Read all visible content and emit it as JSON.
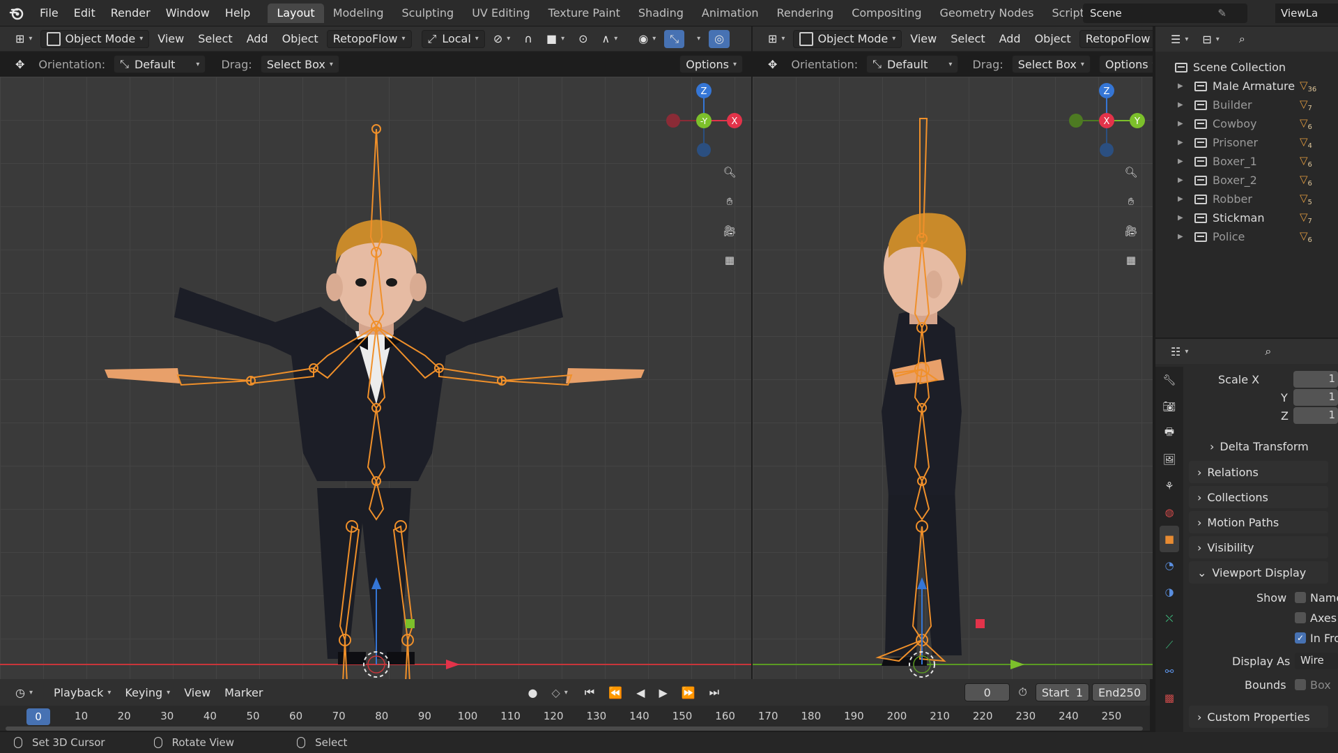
{
  "app": {
    "menus": [
      "File",
      "Edit",
      "Render",
      "Window",
      "Help"
    ],
    "workspaces": [
      "Layout",
      "Modeling",
      "Sculpting",
      "UV Editing",
      "Texture Paint",
      "Shading",
      "Animation",
      "Rendering",
      "Compositing",
      "Geometry Nodes",
      "Scripting"
    ],
    "active_workspace": "Layout",
    "scene": "Scene",
    "view_layer": "ViewLa"
  },
  "viewport_left": {
    "mode": "Object Mode",
    "menu": [
      "View",
      "Select",
      "Add",
      "Object"
    ],
    "addon_menu": "RetopoFlow",
    "transform_space": "Local",
    "orientation_label": "Orientation:",
    "orientation_value": "Default",
    "drag_label": "Drag:",
    "drag_value": "Select Box",
    "options": "Options",
    "gizmo": {
      "z": "Z",
      "y": "-Y",
      "x": "X"
    }
  },
  "viewport_right": {
    "mode": "Object Mode",
    "menu": [
      "View",
      "Select",
      "Add",
      "Object"
    ],
    "addon_menu": "RetopoFlow",
    "orientation_label": "Orientation:",
    "orientation_value": "Default",
    "drag_label": "Drag:",
    "drag_value": "Select Box",
    "options": "Options",
    "gizmo": {
      "z": "Z",
      "x": "X",
      "y": "Y"
    }
  },
  "outliner": {
    "root": "Scene Collection",
    "items": [
      {
        "label": "Male Armature",
        "count": "36",
        "dim": false
      },
      {
        "label": "Builder",
        "count": "7",
        "dim": true
      },
      {
        "label": "Cowboy",
        "count": "6",
        "dim": true
      },
      {
        "label": "Prisoner",
        "count": "4",
        "dim": true
      },
      {
        "label": "Boxer_1",
        "count": "6",
        "dim": true
      },
      {
        "label": "Boxer_2",
        "count": "6",
        "dim": true
      },
      {
        "label": "Robber",
        "count": "5",
        "dim": true
      },
      {
        "label": "Stickman",
        "count": "7",
        "dim": false
      },
      {
        "label": "Police",
        "count": "6",
        "dim": true
      }
    ]
  },
  "properties": {
    "scale_x_label": "Scale X",
    "scale_y_label": "Y",
    "scale_z_label": "Z",
    "scale_x": "1",
    "scale_y": "1",
    "scale_z": "1",
    "panels": [
      "Delta Transform",
      "Relations",
      "Collections",
      "Motion Paths",
      "Visibility"
    ],
    "viewport_display": "Viewport Display",
    "show_label": "Show",
    "show_name": "Name",
    "show_axes": "Axes",
    "show_in_front": "In Fro",
    "display_as_label": "Display As",
    "display_as_value": "Wire",
    "bounds_label": "Bounds",
    "bounds_value": "Box",
    "custom_properties": "Custom Properties"
  },
  "timeline": {
    "menus": [
      "Playback",
      "Keying",
      "View",
      "Marker"
    ],
    "current_frame": "0",
    "start_label": "Start",
    "start": "1",
    "end_label": "End",
    "end": "250",
    "ticks": [
      "0",
      "10",
      "20",
      "30",
      "40",
      "50",
      "60",
      "70",
      "80",
      "90",
      "100",
      "110",
      "120",
      "130",
      "140",
      "150",
      "160",
      "170",
      "180",
      "190",
      "200",
      "210",
      "220",
      "230",
      "240",
      "250"
    ]
  },
  "status": {
    "left": "Set 3D Cursor",
    "middle": "Rotate View",
    "right": "Select"
  },
  "colors": {
    "bone": "#f0902a",
    "x_axis": "#e3334a",
    "y_axis": "#7cc02b",
    "z_axis": "#3576d6",
    "accent": "#4772b3"
  }
}
